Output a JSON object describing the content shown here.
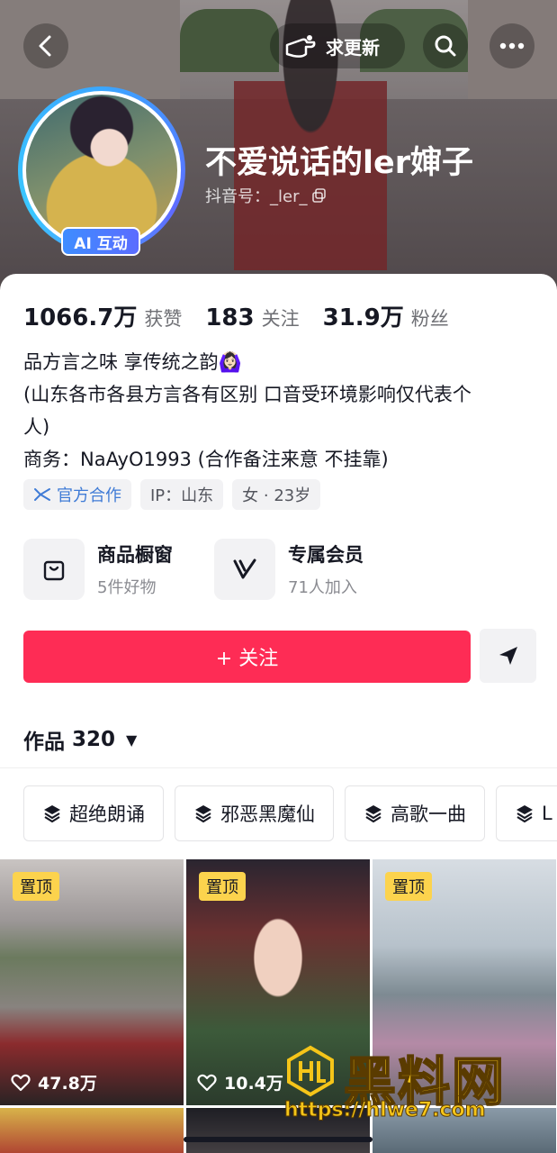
{
  "header": {
    "update_label": "求更新",
    "nickname": "不爱说话的ler婶子",
    "douyin_id_label": "抖音号：_ler_",
    "ai_badge": "AI 互动"
  },
  "stats": [
    {
      "num": "1066.7万",
      "label": "获赞"
    },
    {
      "num": "183",
      "label": "关注"
    },
    {
      "num": "31.9万",
      "label": "粉丝"
    }
  ],
  "bio": {
    "line1": "品方言之味 享传统之韵🙆🏻‍♀️",
    "line2": "(山东各市各县方言各有区别 口音受环境影响仅代表个",
    "line3": "人)",
    "line4": "商务：NaAyO1993 (合作备注来意  不挂靠)"
  },
  "tags": {
    "official": "官方合作",
    "ip": "IP：山东",
    "gender_age": "女 · 23岁"
  },
  "services": [
    {
      "title": "商品橱窗",
      "sub": "5件好物",
      "icon": "shop-bag-icon"
    },
    {
      "title": "专属会员",
      "sub": "71人加入",
      "icon": "vip-v-icon"
    }
  ],
  "actions": {
    "follow_label": "+ 关注"
  },
  "works": {
    "label": "作品",
    "count": "320"
  },
  "collections": [
    "超绝朗诵",
    "邪恶黑魔仙",
    "高歌一曲",
    "L"
  ],
  "videos": [
    {
      "pin": "置顶",
      "likes": "47.8万"
    },
    {
      "pin": "置顶",
      "likes": "10.4万"
    },
    {
      "pin": "置顶",
      "likes": ""
    }
  ],
  "watermark": {
    "text": "黑料网",
    "url": "https://hlwe7.com"
  },
  "colors": {
    "accent": "#fe2c55",
    "pin": "#fcd34d",
    "official": "#3f7bd6"
  }
}
